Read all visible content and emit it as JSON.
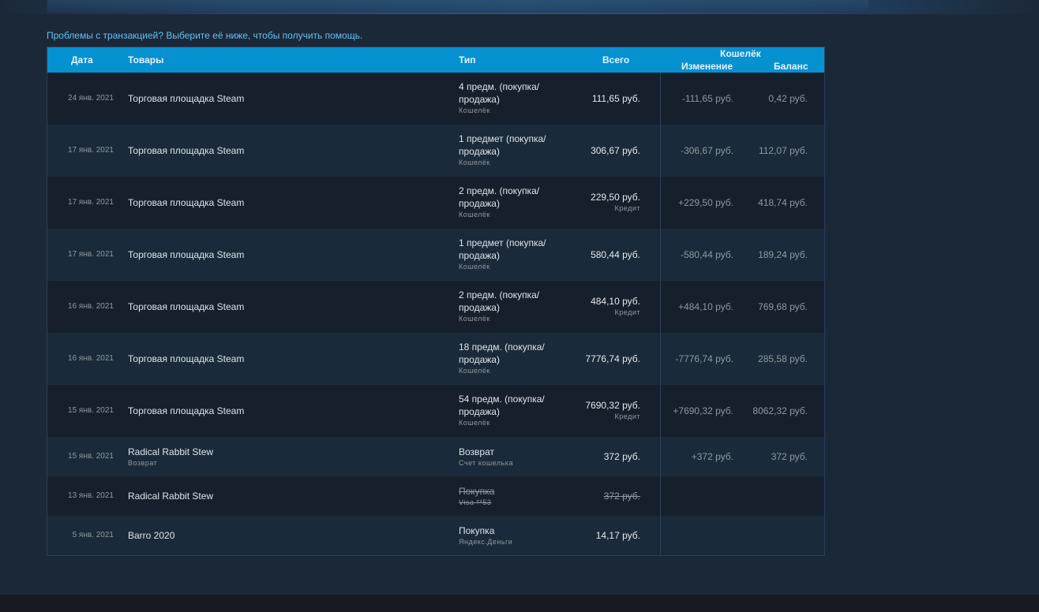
{
  "help_text": "Проблемы с транзакцией? Выберите её ниже, чтобы получить помощь.",
  "headers": {
    "date": "Дата",
    "items": "Товары",
    "type": "Тип",
    "total": "Всего",
    "wallet": "Кошелёк",
    "change": "Изменение",
    "balance": "Баланс"
  },
  "rows": [
    {
      "date": "24 янв. 2021",
      "item": "Торговая площадка Steam",
      "item_sub": "",
      "type_line1": "4 предм. (покупка/",
      "type_line2": "продажа)",
      "type_sub": "Кошелёк",
      "total": "111,65 руб.",
      "total_sub": "",
      "change": "-111,65 руб.",
      "balance": "0,42 руб.",
      "struck": false
    },
    {
      "date": "17 янв. 2021",
      "item": "Торговая площадка Steam",
      "item_sub": "",
      "type_line1": "1 предмет (покупка/",
      "type_line2": "продажа)",
      "type_sub": "Кошелёк",
      "total": "306,67 руб.",
      "total_sub": "",
      "change": "-306,67 руб.",
      "balance": "112,07 руб.",
      "struck": false
    },
    {
      "date": "17 янв. 2021",
      "item": "Торговая площадка Steam",
      "item_sub": "",
      "type_line1": "2 предм. (покупка/",
      "type_line2": "продажа)",
      "type_sub": "Кошелёк",
      "total": "229,50 руб.",
      "total_sub": "Кредит",
      "change": "+229,50 руб.",
      "balance": "418,74 руб.",
      "struck": false
    },
    {
      "date": "17 янв. 2021",
      "item": "Торговая площадка Steam",
      "item_sub": "",
      "type_line1": "1 предмет (покупка/",
      "type_line2": "продажа)",
      "type_sub": "Кошелёк",
      "total": "580,44 руб.",
      "total_sub": "",
      "change": "-580,44 руб.",
      "balance": "189,24 руб.",
      "struck": false
    },
    {
      "date": "16 янв. 2021",
      "item": "Торговая площадка Steam",
      "item_sub": "",
      "type_line1": "2 предм. (покупка/",
      "type_line2": "продажа)",
      "type_sub": "Кошелёк",
      "total": "484,10 руб.",
      "total_sub": "Кредит",
      "change": "+484,10 руб.",
      "balance": "769,68 руб.",
      "struck": false
    },
    {
      "date": "16 янв. 2021",
      "item": "Торговая площадка Steam",
      "item_sub": "",
      "type_line1": "18 предм. (покупка/",
      "type_line2": "продажа)",
      "type_sub": "Кошелёк",
      "total": "7776,74 руб.",
      "total_sub": "",
      "change": "-7776,74 руб.",
      "balance": "285,58 руб.",
      "struck": false
    },
    {
      "date": "15 янв. 2021",
      "item": "Торговая площадка Steam",
      "item_sub": "",
      "type_line1": "54 предм. (покупка/",
      "type_line2": "продажа)",
      "type_sub": "Кошелёк",
      "total": "7690,32 руб.",
      "total_sub": "Кредит",
      "change": "+7690,32 руб.",
      "balance": "8062,32 руб.",
      "struck": false
    },
    {
      "date": "15 янв. 2021",
      "item": "Radical Rabbit Stew",
      "item_sub": "Возврат",
      "type_line1": "Возврат",
      "type_line2": "",
      "type_sub": "Счет кошелька",
      "total": "372 руб.",
      "total_sub": "",
      "change": "+372 руб.",
      "balance": "372 руб.",
      "struck": false
    },
    {
      "date": "13 янв. 2021",
      "item": "Radical Rabbit Stew",
      "item_sub": "",
      "type_line1": "Покупка",
      "type_line2": "",
      "type_sub": "Visa **53",
      "total": "372 руб.",
      "total_sub": "",
      "change": "",
      "balance": "",
      "struck": true
    },
    {
      "date": "5 янв. 2021",
      "item": "Barro 2020",
      "item_sub": "",
      "type_line1": "Покупка",
      "type_line2": "",
      "type_sub": "Яндекс.Деньги",
      "total": "14,17 руб.",
      "total_sub": "",
      "change": "",
      "balance": "",
      "struck": false
    }
  ]
}
